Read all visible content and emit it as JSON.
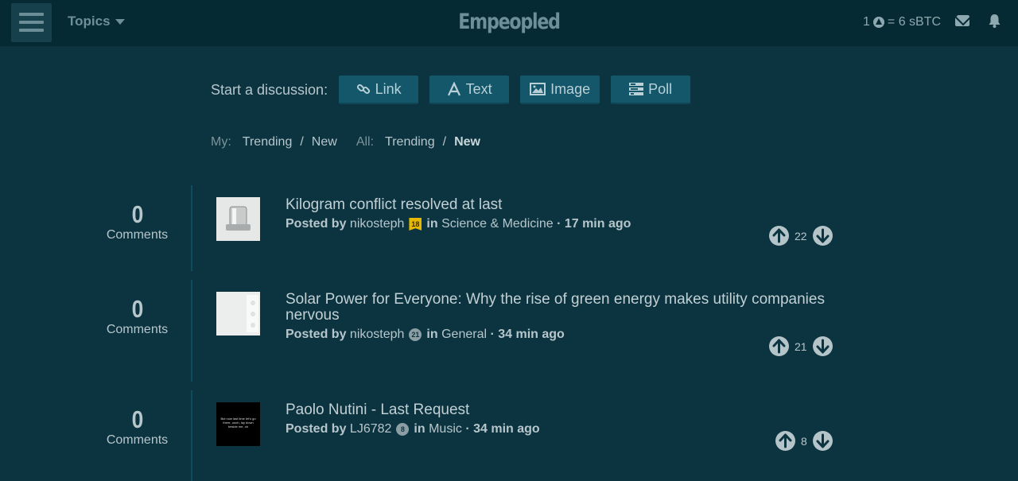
{
  "header": {
    "topics_label": "Topics",
    "logo": "Empeopled",
    "rate_left": "1",
    "rate_right": "= 6 sBTC"
  },
  "start": {
    "label": "Start a discussion:",
    "link": "Link",
    "text": "Text",
    "image": "Image",
    "poll": "Poll"
  },
  "filters": {
    "my_label": "My:",
    "my_trending": "Trending",
    "my_new": "New",
    "all_label": "All:",
    "all_trending": "Trending",
    "all_new": "New",
    "sep": "/"
  },
  "posts": [
    {
      "comments": "0",
      "comments_label": "Comments",
      "title": "Kilogram conflict resolved at last",
      "posted_by": "Posted by",
      "author": "nikosteph",
      "level": "18",
      "in": "in",
      "topic": "Science & Medicine",
      "time": "· 17 min ago",
      "votes": "22"
    },
    {
      "comments": "0",
      "comments_label": "Comments",
      "title": "Solar Power for Everyone: Why the rise of green energy makes utility companies nervous",
      "posted_by": "Posted by",
      "author": "nikosteph",
      "level": "21",
      "in": "in",
      "topic": "General",
      "time": "· 34 min ago",
      "votes": "21"
    },
    {
      "comments": "0",
      "comments_label": "Comments",
      "title": "Paolo Nutini - Last Request",
      "posted_by": "Posted by",
      "author": "LJ6782",
      "level": "8",
      "in": "in",
      "topic": "Music",
      "time": "· 34 min ago",
      "votes": "8",
      "thumb_text": "But now last time let's go there, oooh, lay down beside me, oh"
    }
  ]
}
